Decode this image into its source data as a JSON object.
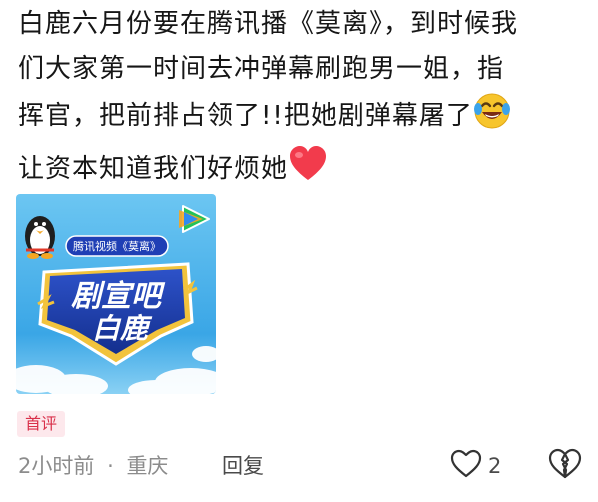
{
  "comment": {
    "line1": "白鹿六月份要在腾讯播《莫离》，到时候我",
    "line2": "们大家第一时间去冲弹幕刷跑男一姐，指",
    "line3": "挥官，把前排占领了!!把她剧弹幕屠了",
    "line4": "让资本知道我们好烦她"
  },
  "image": {
    "tag_text": "腾讯视频《莫离》",
    "title_line1": "剧宣吧",
    "title_line2": "白鹿",
    "colors": {
      "sky": "#4fb8ef",
      "banner": "#1a3aa8",
      "gold": "#f2c33c"
    }
  },
  "badge": {
    "label": "首评"
  },
  "meta": {
    "time": "2小时前",
    "separator": "·",
    "location": "重庆",
    "reply_label": "回复",
    "like_count": "2"
  },
  "icons": {
    "emoji_1": "laughing-tears-emoji",
    "emoji_2": "red-heart-emoji",
    "like": "heart-outline-icon",
    "dislike": "broken-heart-outline-icon"
  }
}
